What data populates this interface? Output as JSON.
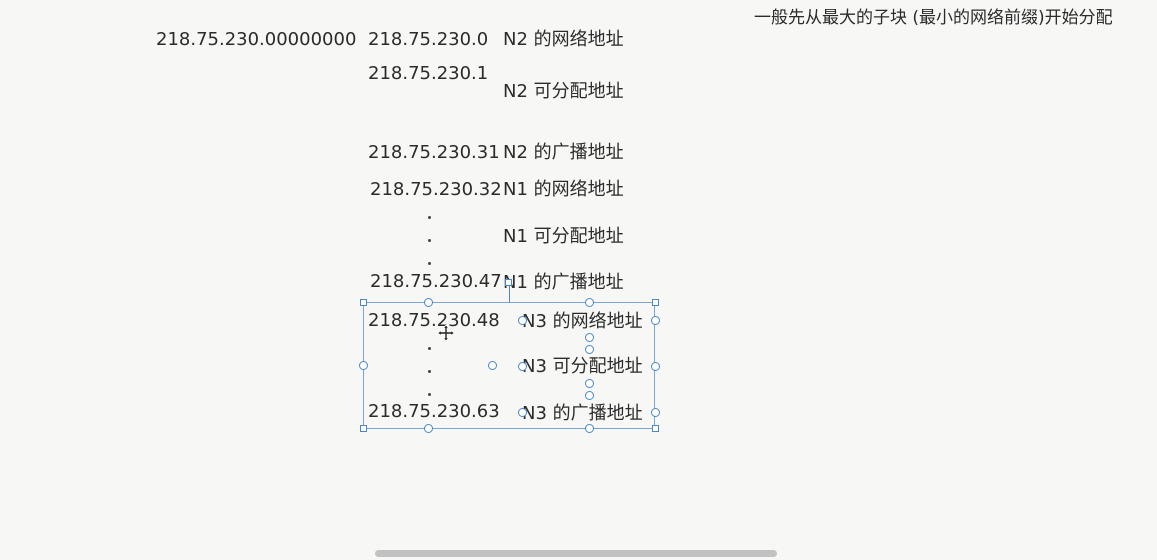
{
  "note": "一般先从最大的子块 (最小的网络前缀)开始分配",
  "binary_prefix": "218.75.230.00000000",
  "rows": [
    {
      "ip": "218.75.230.0",
      "label": "N2 的网络地址"
    },
    {
      "ip": "218.75.230.1",
      "label": "N2 可分配地址"
    },
    {
      "ip": "218.75.230.31",
      "label": "N2 的广播地址"
    },
    {
      "ip": "218.75.230.32",
      "label": "N1 的网络地址"
    },
    {
      "ip": "",
      "label": "N1 可分配地址"
    },
    {
      "ip": "218.75.230.47",
      "label": "N1 的广播地址"
    },
    {
      "ip": "218.75.230.48",
      "label": "N3 的网络地址"
    },
    {
      "ip": "",
      "label": "N3 可分配地址"
    },
    {
      "ip": "218.75.230.63",
      "label": "N3 的广播地址"
    }
  ],
  "ellipsis_char": "."
}
